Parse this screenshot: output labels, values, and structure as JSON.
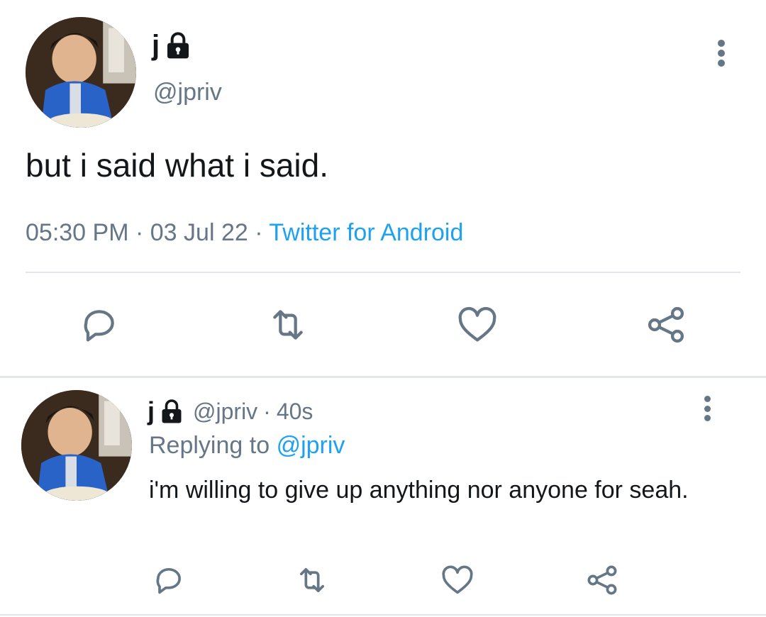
{
  "main_tweet": {
    "display_name": "j",
    "handle": "@jpriv",
    "text": "but i said what i said.",
    "time": "05:30 PM",
    "separator": "·",
    "date": "03 Jul 22",
    "source": "Twitter for Android",
    "icons": {
      "lock": "lock-icon",
      "more": "more-vertical-icon",
      "reply": "reply-icon",
      "retweet": "retweet-icon",
      "like": "heart-icon",
      "share": "share-icon"
    }
  },
  "reply_tweet": {
    "display_name": "j",
    "handle": "@jpriv",
    "separator": "·",
    "age": "40s",
    "replying_prefix": "Replying to",
    "replying_handle": "@jpriv",
    "text": "i'm willing to give up anything nor anyone for seah."
  },
  "colors": {
    "accent": "#1da1f2",
    "muted": "#657786",
    "text": "#14171a",
    "divider": "#e1e8ed"
  }
}
